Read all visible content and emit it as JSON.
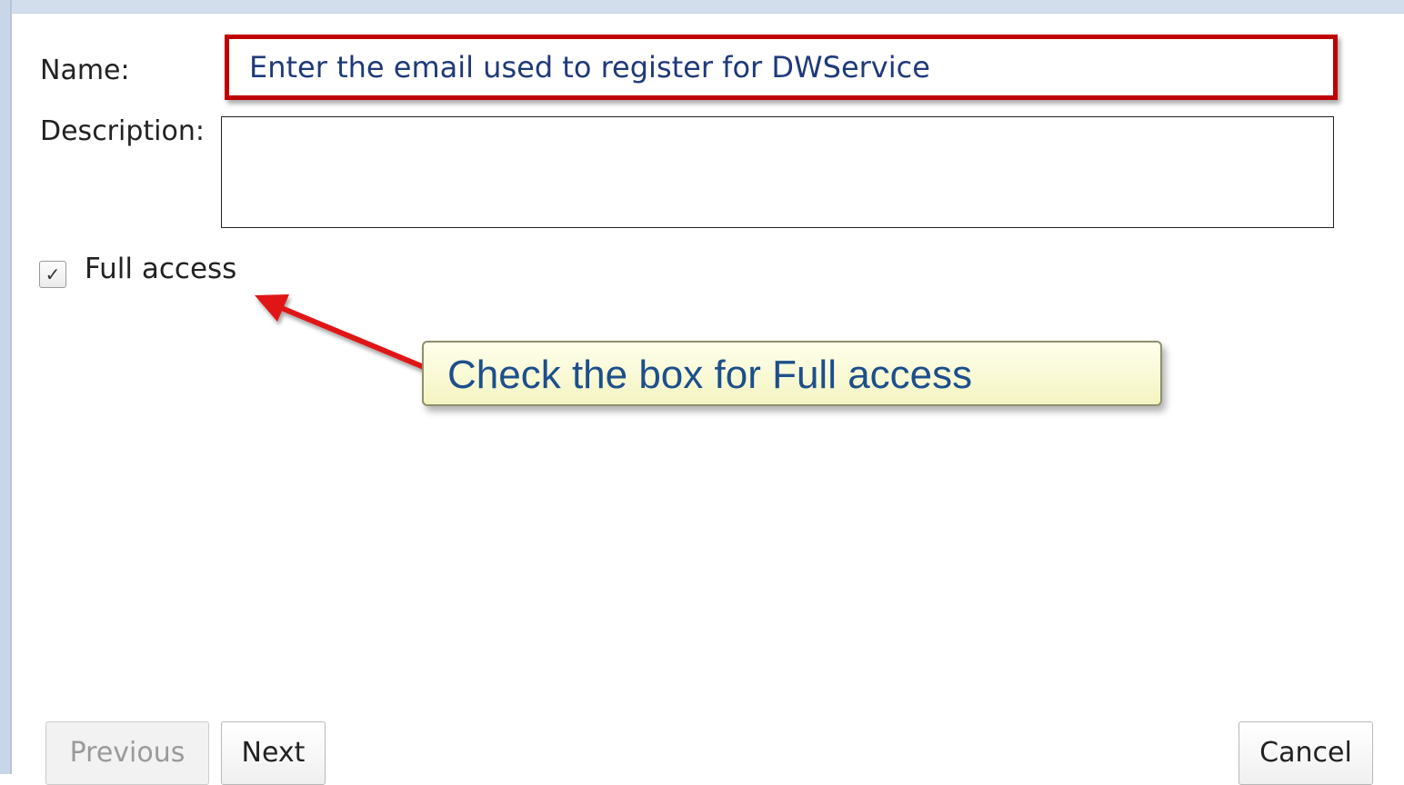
{
  "form": {
    "name_label": "Name:",
    "name_value": "Enter the email used to register for DWService",
    "description_label": "Description:",
    "description_value": "",
    "full_access_label": "Full access",
    "full_access_checked": true,
    "checkmark_glyph": "✓"
  },
  "annotation": {
    "callout_text": "Check the box for Full access",
    "arrow_color": "#e01818",
    "highlight_color": "#c00000"
  },
  "buttons": {
    "previous_label": "Previous",
    "previous_enabled": false,
    "next_label": "Next",
    "cancel_label": "Cancel"
  }
}
